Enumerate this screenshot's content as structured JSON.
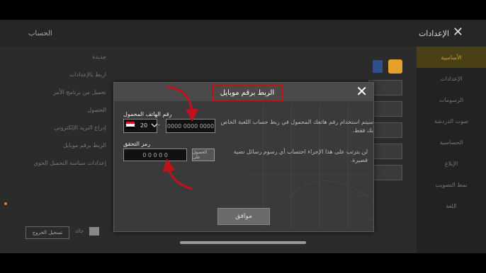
{
  "topbar": {
    "left_title": "الحساب",
    "right_title": "الإعدادات",
    "close": "✕"
  },
  "left_panel": {
    "items": [
      "جديدة",
      "اربط بالإعدادات",
      "تحميل من برنامج الأمر",
      "الحصول",
      "إدراج البريد الإلكتروني",
      "الربط برقم موبايل",
      "إعدادات سياسة التحميل الجوي"
    ]
  },
  "right_nav": {
    "items": [
      "الأساسية",
      "الإعدادات",
      "الرسومات",
      "صوت الدردشة",
      "الحساسية",
      "الإبلاغ",
      "نمط التصويب",
      "اللغة"
    ],
    "active_index": 0
  },
  "bottom": {
    "left_button": "تسجيل الخروج",
    "left_label": "حالة"
  },
  "dialog": {
    "title": "الربط برقم موبايل",
    "close": "✕",
    "phone_label": "رقم الهاتف المحمول",
    "country_code": "20",
    "phone_placeholder": "0000 0000 0000",
    "phone_description": "سيتم استخدام رقم هاتفك المحمول في ربط حساب اللعبة الخاص بك فقط.",
    "verify_label": "رمز التحقق",
    "verify_placeholder": "0 0 0 0 0",
    "get_code_button": "الحصول على",
    "verify_description": "لن يترتب على هذا الإجراء احتساب أي رسوم رسائل نصية قصيرة.",
    "ok_button": "موافق"
  },
  "colors": {
    "accent_red": "#c0121c",
    "gold": "#c9a53a",
    "orange_dot": "#e07a1e"
  },
  "icons": {
    "dropdown": "chevron-down-icon",
    "flag": "egypt-flag-icon"
  }
}
